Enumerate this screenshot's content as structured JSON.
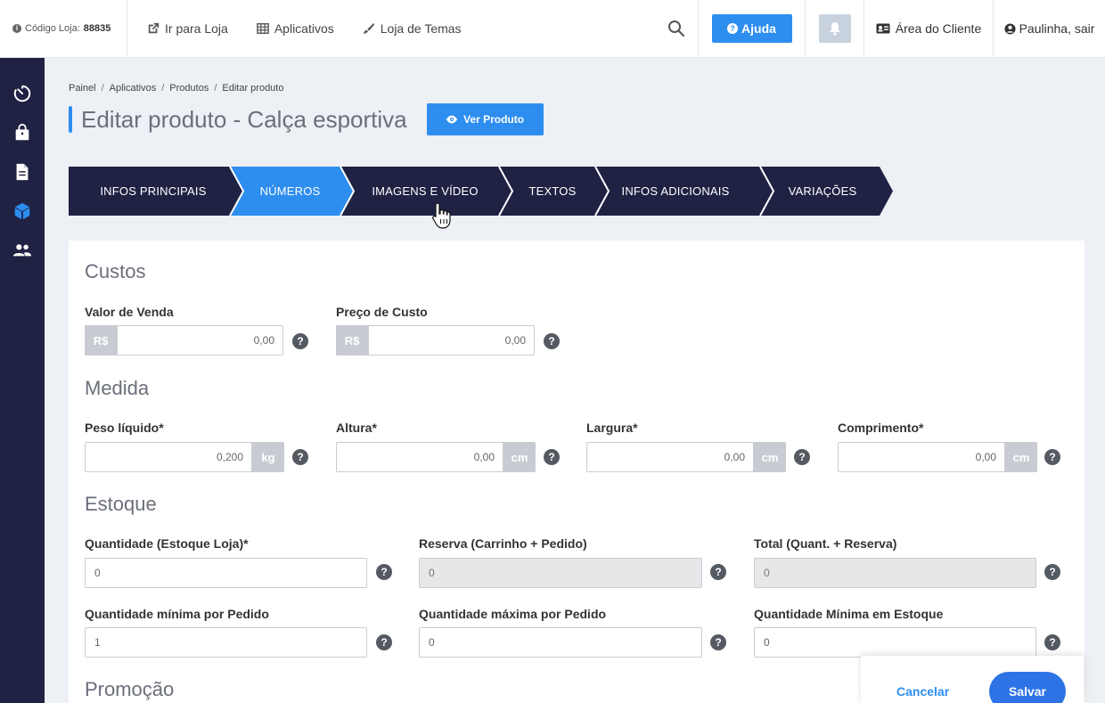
{
  "topbar": {
    "store_code_label": "Código Loja:",
    "store_code_value": "88835",
    "links": [
      {
        "label": "Ir para Loja",
        "icon": "external-link-icon"
      },
      {
        "label": "Aplicativos",
        "icon": "grid-icon"
      },
      {
        "label": "Loja de Temas",
        "icon": "brush-icon"
      }
    ],
    "help_label": "Ajuda",
    "client_area_label": "Área do Cliente",
    "user_label": "Paulinha, sair"
  },
  "sidebar": {
    "items": [
      {
        "icon": "timer-icon"
      },
      {
        "icon": "shopping-bag-icon"
      },
      {
        "icon": "document-icon"
      },
      {
        "icon": "cube-icon"
      },
      {
        "icon": "users-icon"
      }
    ]
  },
  "breadcrumb": [
    "Painel",
    "Aplicativos",
    "Produtos",
    "Editar produto"
  ],
  "page": {
    "title": "Editar produto - Calça esportiva",
    "view_button": "Ver Produto"
  },
  "tabs": [
    {
      "label": "INFOS PRINCIPAIS",
      "active": false
    },
    {
      "label": "NÚMEROS",
      "active": true
    },
    {
      "label": "IMAGENS E VÍDEO",
      "active": false
    },
    {
      "label": "TEXTOS",
      "active": false
    },
    {
      "label": "INFOS ADICIONAIS",
      "active": false
    },
    {
      "label": "VARIAÇÕES",
      "active": false
    }
  ],
  "sections": {
    "costs": {
      "title": "Custos",
      "sale_price": {
        "label": "Valor de Venda",
        "prefix": "R$",
        "value": "0,00"
      },
      "cost_price": {
        "label": "Preço de Custo",
        "prefix": "R$",
        "value": "0,00"
      }
    },
    "measure": {
      "title": "Medida",
      "weight": {
        "label": "Peso líquido*",
        "value": "0,200",
        "unit": "kg"
      },
      "height": {
        "label": "Altura*",
        "value": "0,00",
        "unit": "cm"
      },
      "width": {
        "label": "Largura*",
        "value": "0,00",
        "unit": "cm"
      },
      "length": {
        "label": "Comprimento*",
        "value": "0,00",
        "unit": "cm"
      }
    },
    "stock": {
      "title": "Estoque",
      "quantity": {
        "label": "Quantidade (Estoque Loja)*",
        "value": "0"
      },
      "reserve": {
        "label": "Reserva (Carrinho + Pedido)",
        "value": "0"
      },
      "total": {
        "label": "Total (Quant. + Reserva)",
        "value": "0"
      },
      "min_order": {
        "label": "Quantidade mínima por Pedido",
        "value": "1"
      },
      "max_order": {
        "label": "Quantidade máxima por Pedido",
        "value": "0"
      },
      "min_stock": {
        "label": "Quantidade Mínima em Estoque",
        "value": "0"
      }
    },
    "promo": {
      "title": "Promoção"
    }
  },
  "help_glyph": "?",
  "actions": {
    "cancel": "Cancelar",
    "save": "Salvar"
  },
  "colors": {
    "accent": "#2d8ef0",
    "sidebar": "#202244",
    "tab_dark": "#202244"
  }
}
